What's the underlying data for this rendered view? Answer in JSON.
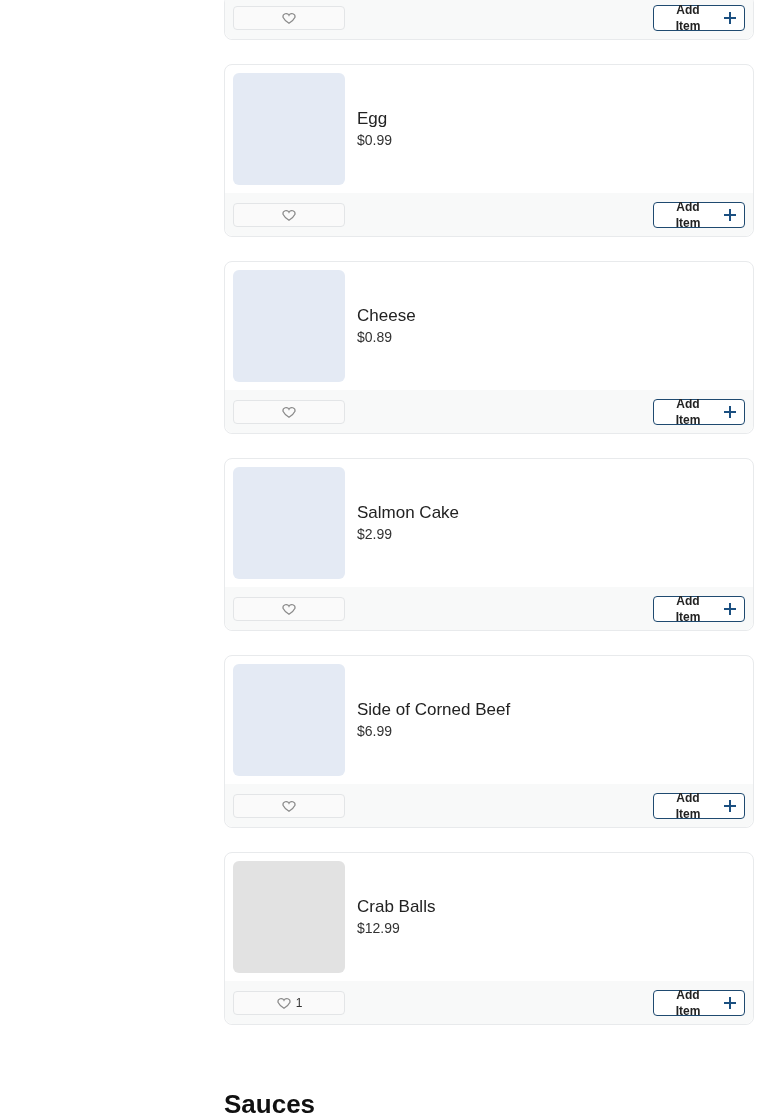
{
  "items": [
    {
      "kind": "footer_only",
      "button": "Add Item"
    },
    {
      "kind": "full",
      "name": "Egg",
      "price": "$0.99",
      "color": "#e4eaf4",
      "button": "Add Item"
    },
    {
      "kind": "full",
      "name": "Cheese",
      "price": "$0.89",
      "color": "#e4eaf4",
      "button": "Add Item"
    },
    {
      "kind": "full",
      "name": "Salmon Cake",
      "price": "$2.99",
      "color": "#e4eaf4",
      "button": "Add Item"
    },
    {
      "kind": "full",
      "name": "Side of Corned Beef",
      "price": "$6.99",
      "color": "#e4eaf4",
      "button": "Add Item"
    },
    {
      "kind": "full",
      "name": "Crab Balls",
      "price": "$12.99",
      "color": "#e2e2e2",
      "likes": "1",
      "button": "Add Item"
    }
  ],
  "next_section": "Sauces"
}
